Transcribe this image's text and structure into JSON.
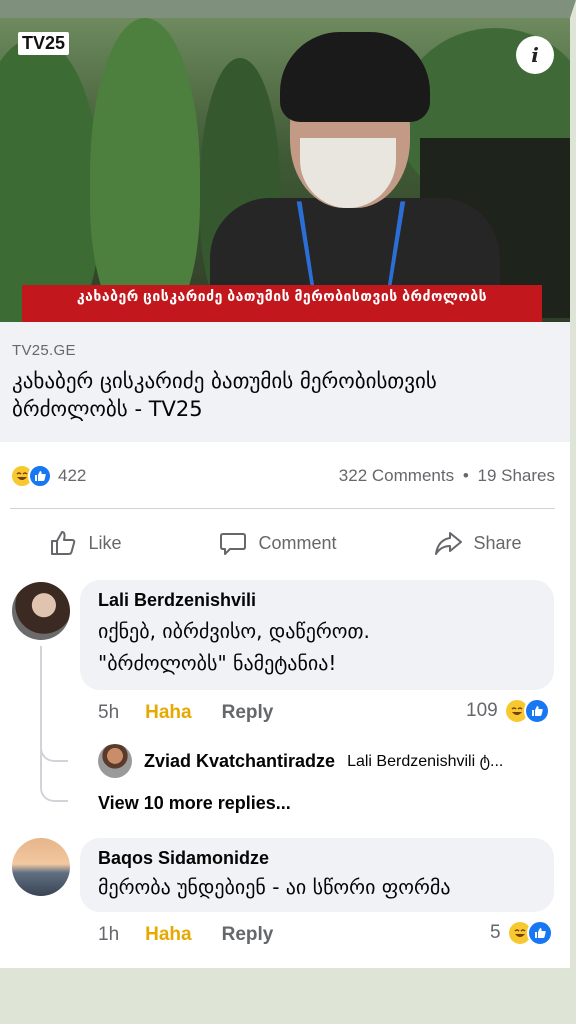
{
  "post": {
    "media": {
      "logo": "TV25",
      "info_icon": "i",
      "banner_text": "კახაბერ ცისკარიძე ბათუმის მერობისთვის ბრძოლობს"
    },
    "link": {
      "domain": "TV25.GE",
      "title": "კახაბერ ცისკარიძე ბათუმის მერობისთვის ბრძოლობს - TV25"
    },
    "stats": {
      "reaction_count": "422",
      "comments": "322 Comments",
      "separator": "•",
      "shares": "19 Shares"
    },
    "actions": {
      "like": "Like",
      "comment": "Comment",
      "share": "Share"
    }
  },
  "comments": [
    {
      "author": "Lali Berdzenishvili",
      "text_line1": "იქნებ, იბრძვისო, დაწეროთ.",
      "text_line2": "\"ბრძოლობს\" ნამეტანია!",
      "time": "5h",
      "reaction_label": "Haha",
      "reply_label": "Reply",
      "reaction_count": "109",
      "reply": {
        "author": "Zviad Kvatchantiradze",
        "text": "Lali Berdzenishvili ტ..."
      },
      "more_replies": "View 10 more replies..."
    },
    {
      "author": "Baqos Sidamonidze",
      "text": "მერობა უნდებიენ - აი სწორი ფორმა",
      "time": "1h",
      "reaction_label": "Haha",
      "reply_label": "Reply",
      "reaction_count": "5"
    }
  ],
  "colors": {
    "accent_blue": "#1877f2",
    "haha_yellow": "#e7a900",
    "banner_red": "#c2181d",
    "secondary_text": "#65676b"
  }
}
